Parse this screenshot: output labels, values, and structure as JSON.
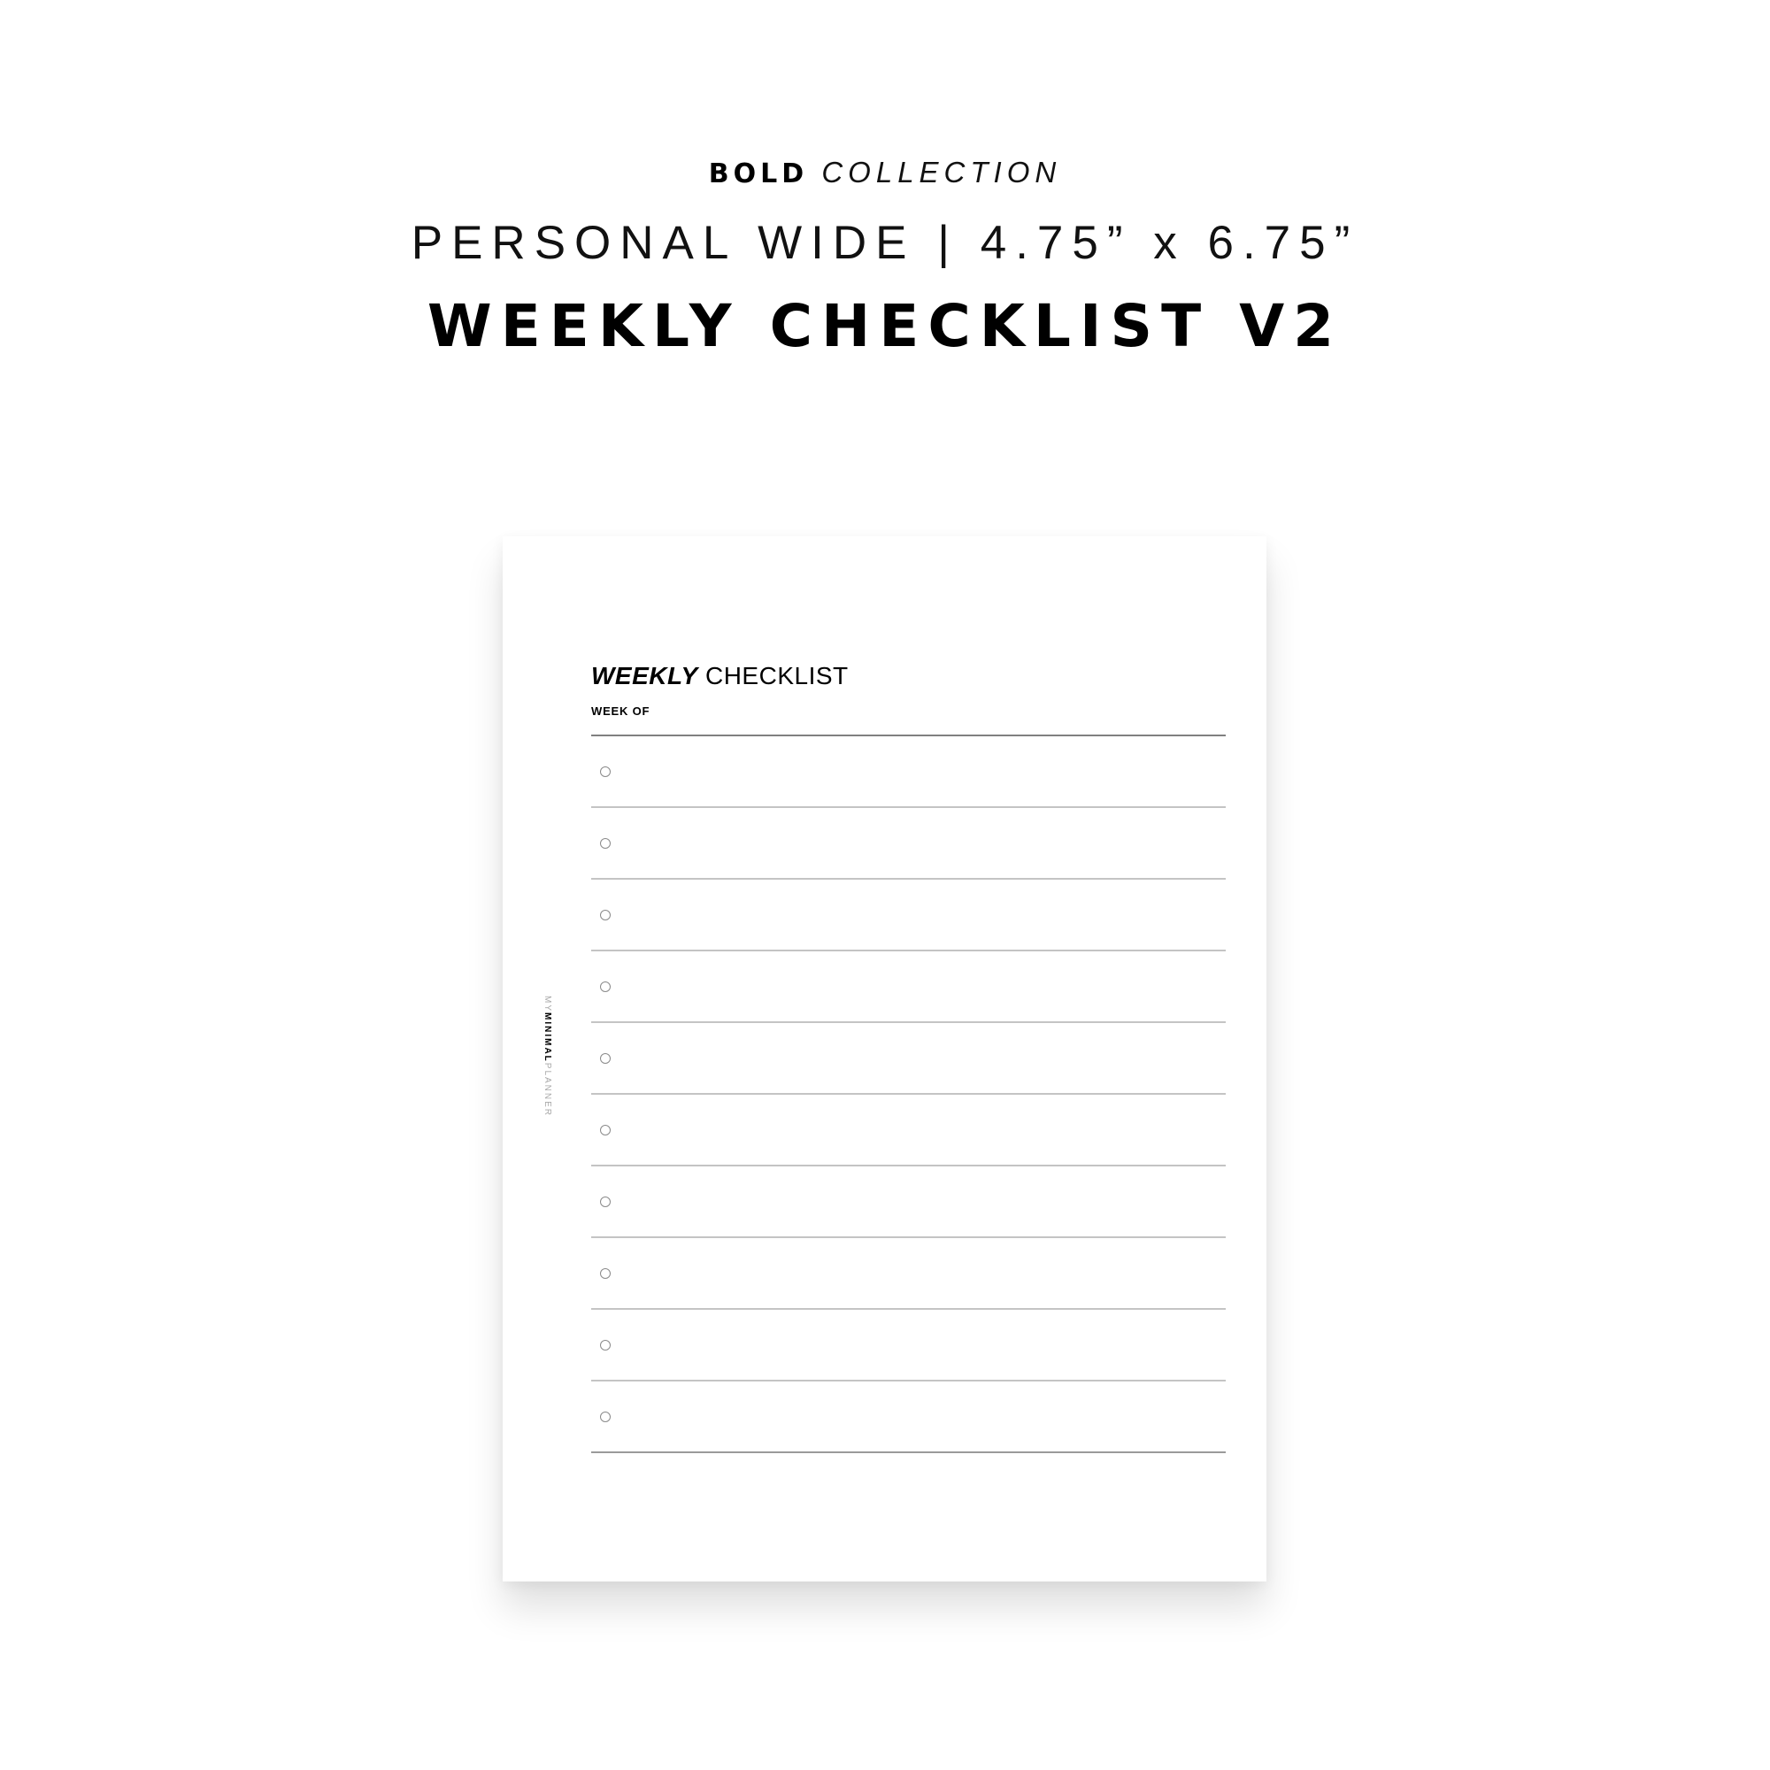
{
  "header": {
    "collection_bold": "BOLD",
    "collection_italic": "COLLECTION",
    "size_label": "PERSONAL WIDE | 4.75” x 6.75”",
    "product_title": "WEEKLY CHECKLIST V2"
  },
  "page": {
    "title_italic": "WEEKLY",
    "title_regular": "CHECKLIST",
    "week_of_label": "WEEK OF",
    "checklist_rows": 10,
    "checkbox_icon": "circle-outline",
    "brand": {
      "prefix": "MY",
      "bold": "MINIMAL",
      "suffix": "PLANNER"
    }
  },
  "colors": {
    "text": "#000000",
    "divider_primary": "#808080",
    "row_line": "#c4c4c4",
    "checkbox": "#8a8a8a",
    "brand_light": "#a8a8a8"
  }
}
